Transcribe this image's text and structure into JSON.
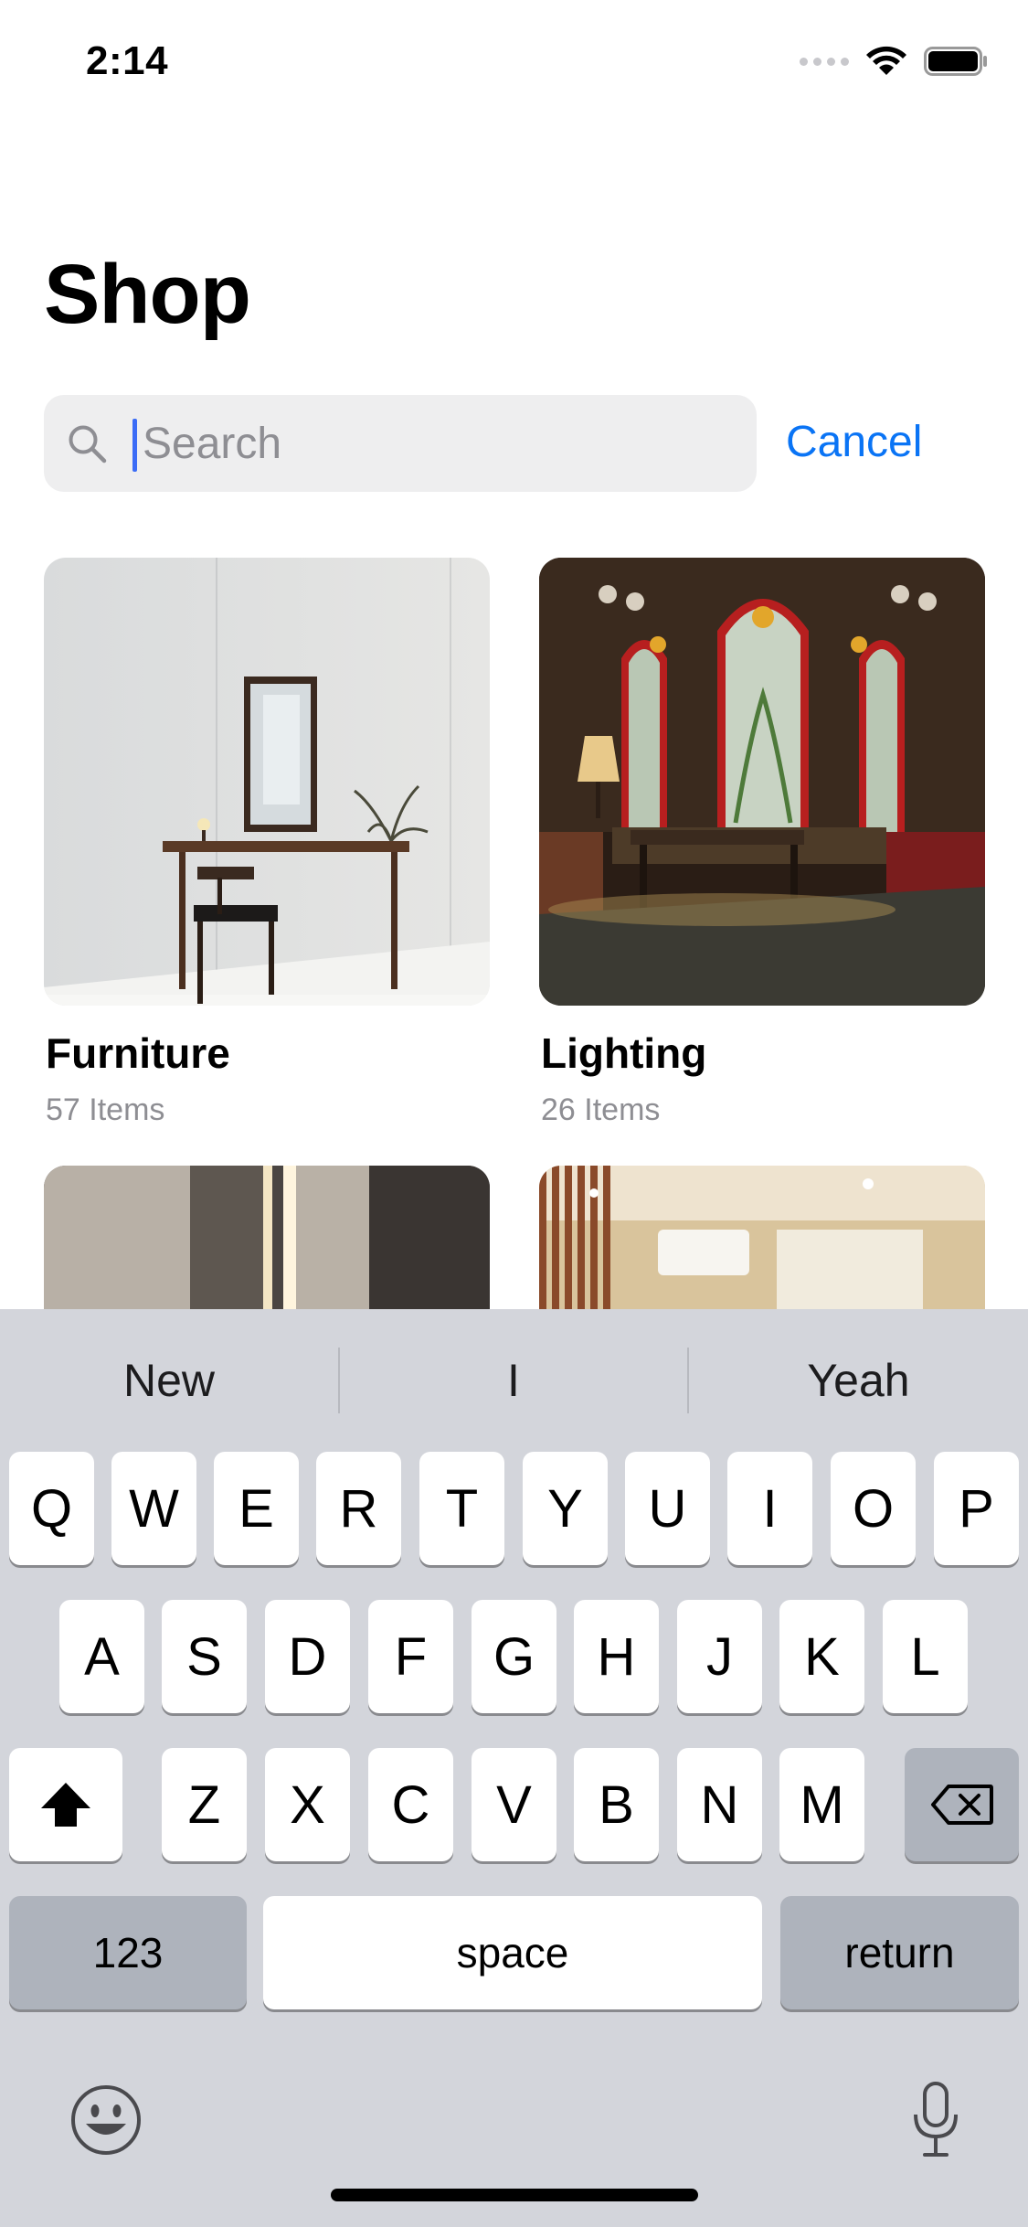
{
  "status_bar": {
    "time": "2:14"
  },
  "header": {
    "title": "Shop"
  },
  "search": {
    "placeholder": "Search",
    "value": "",
    "cancel_label": "Cancel"
  },
  "categories": [
    {
      "name": "Furniture",
      "count": "57 Items"
    },
    {
      "name": "Lighting",
      "count": "26 Items"
    },
    {
      "name": "",
      "count": ""
    },
    {
      "name": "",
      "count": ""
    }
  ],
  "keyboard": {
    "suggestions": [
      "New",
      "I",
      "Yeah"
    ],
    "rows": [
      [
        "Q",
        "W",
        "E",
        "R",
        "T",
        "Y",
        "U",
        "I",
        "O",
        "P"
      ],
      [
        "A",
        "S",
        "D",
        "F",
        "G",
        "H",
        "J",
        "K",
        "L"
      ],
      [
        "Z",
        "X",
        "C",
        "V",
        "B",
        "N",
        "M"
      ]
    ],
    "numbers_label": "123",
    "space_label": "space",
    "return_label": "return"
  },
  "colors": {
    "accent": "#0A74F5",
    "caret": "#3B6CF6",
    "keyboard_bg": "#D3D5DB",
    "secondary_text": "#8E8E93"
  }
}
